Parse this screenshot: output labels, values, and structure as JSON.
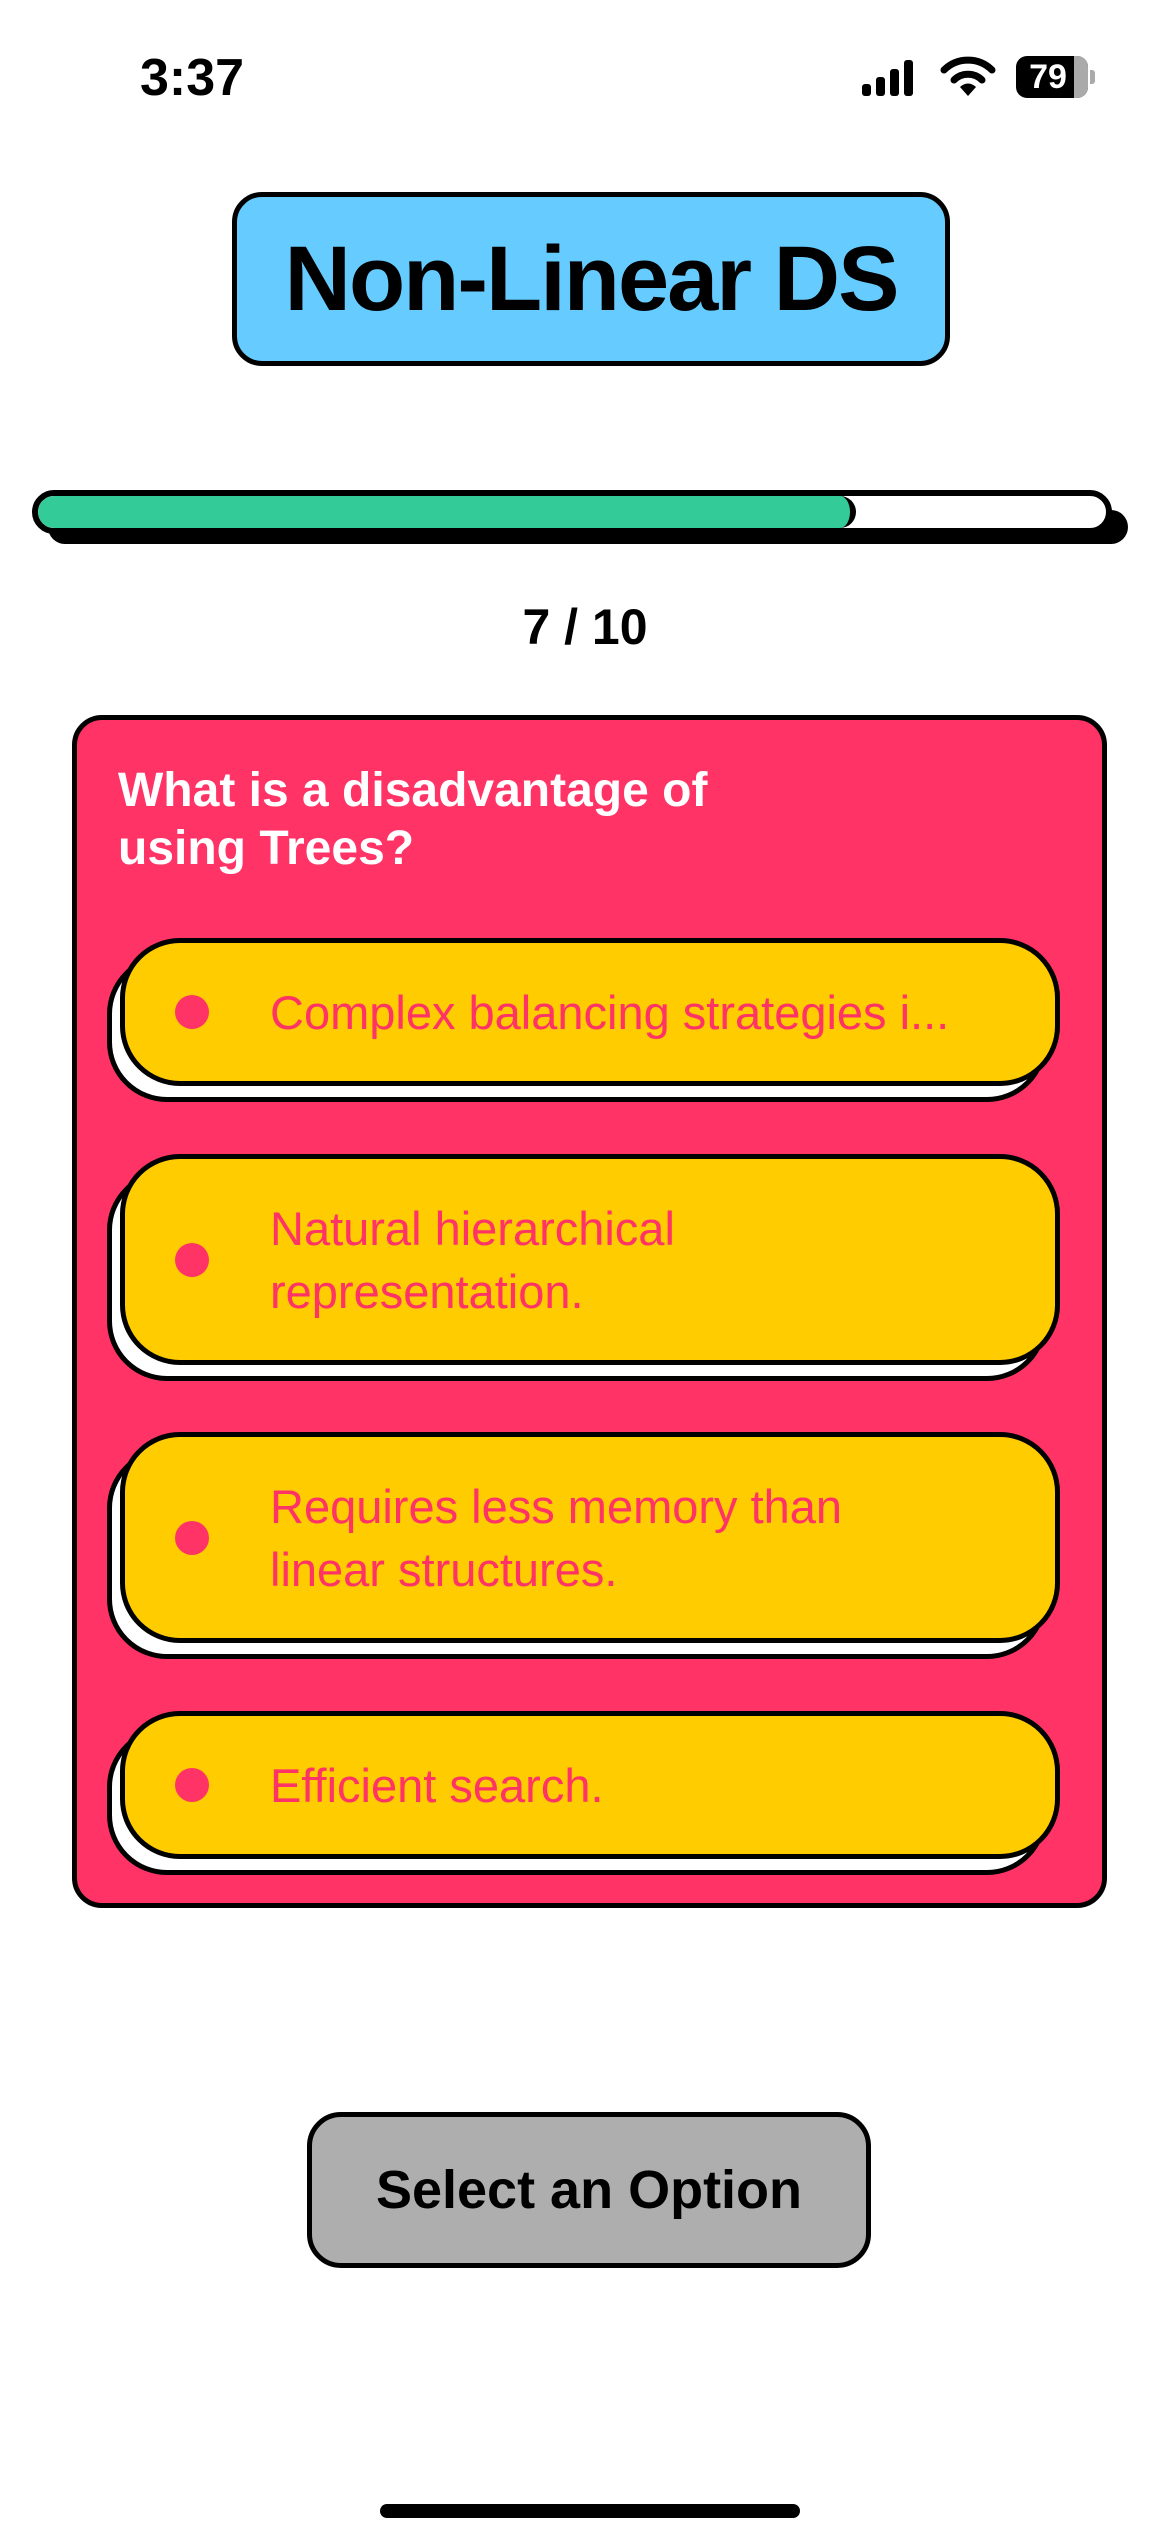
{
  "status_bar": {
    "time": "3:37",
    "battery": "79",
    "icons": [
      "cellular-signal-icon",
      "wifi-icon",
      "battery-icon"
    ]
  },
  "header": {
    "title": "Non-Linear DS"
  },
  "progress": {
    "fraction": 0.76,
    "label": "7 / 10"
  },
  "quiz": {
    "question": "What is a disadvantage of using Trees?",
    "options": [
      {
        "label": "Complex balancing strategies i..."
      },
      {
        "label": "Natural hierarchical\nrepresentation."
      },
      {
        "label": "Requires less memory than\nlinear structures."
      },
      {
        "label": "Efficient search."
      }
    ]
  },
  "footer": {
    "button_label": "Select an Option"
  },
  "colors": {
    "title_bg": "#66CCFF",
    "progress": "#33CC99",
    "card": "#FF3366",
    "option": "#FFCC00",
    "button": "#AEAEAE"
  }
}
